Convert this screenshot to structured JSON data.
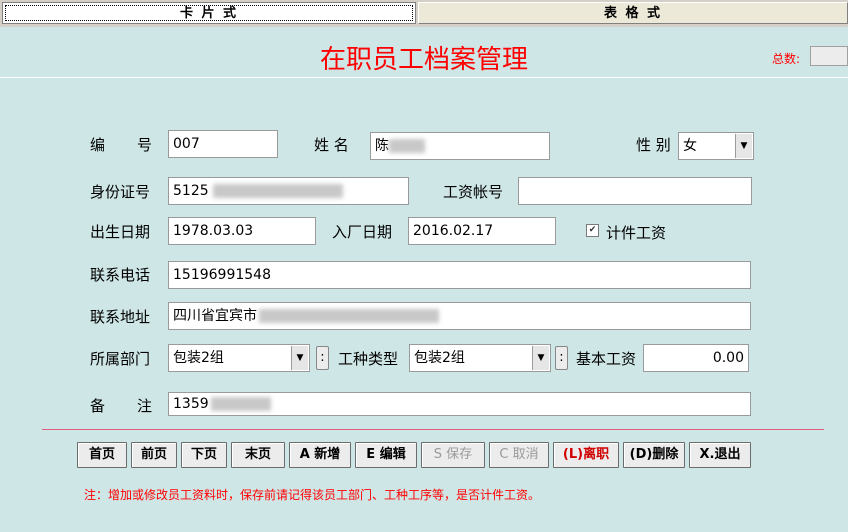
{
  "tabs": {
    "card": "卡 片 式",
    "table": "表 格 式"
  },
  "header": {
    "title": "在职员工档案管理",
    "total_label": "总数:"
  },
  "form": {
    "id_label": "编号",
    "id_value": "007",
    "name_label": "姓 名",
    "name_value": "陈",
    "gender_label": "性 别",
    "gender_value": "女",
    "idcard_label": "身份证号",
    "idcard_value": "5125",
    "payaccount_label": "工资帐号",
    "payaccount_value": "",
    "birth_label": "出生日期",
    "birth_value": "1978.03.03",
    "entry_label": "入厂日期",
    "entry_value": "2016.02.17",
    "piecework_label": "计件工资",
    "phone_label": "联系电话",
    "phone_value": "15196991548",
    "address_label": "联系地址",
    "address_value": "四川省宜宾市",
    "dept_label": "所属部门",
    "dept_value": "包装2组",
    "worktype_label": "工种类型",
    "worktype_value": "包装2组",
    "basesalary_label": "基本工资",
    "basesalary_value": "0.00",
    "remark_label": "备注",
    "remark_value": "1359"
  },
  "buttons": {
    "first": "首页",
    "prev": "前页",
    "next": "下页",
    "last": "末页",
    "add": "A 新增",
    "edit": "E 编辑",
    "save": "S 保存",
    "cancel": "C 取消",
    "resign": "(L)离职",
    "delete": "(D)删除",
    "exit": "X.退出"
  },
  "note": "注：增加或修改员工资料时，保存前请记得该员工部门、工种工序等，是否计件工资。",
  "colors": {
    "title": "#ff0000",
    "background": "#cfe6e6"
  }
}
